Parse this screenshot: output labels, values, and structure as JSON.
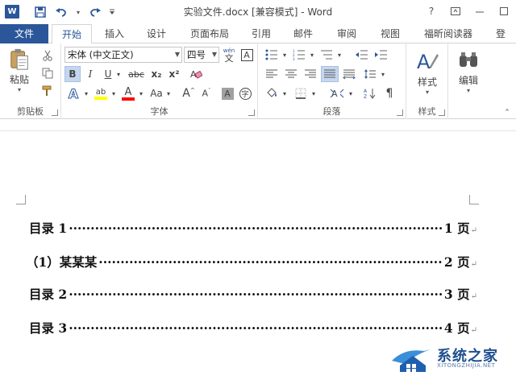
{
  "window": {
    "title": "实验文件.docx [兼容模式] - Word",
    "app_icon": "W",
    "controls": {
      "help": "?",
      "restore_ribbon": "⊡",
      "minimize": "—",
      "maximize": "□"
    }
  },
  "qat": {
    "save_icon": "save-icon",
    "undo_icon": "undo-icon",
    "redo_icon": "redo-icon"
  },
  "tabs": {
    "file": "文件",
    "items": [
      "开始",
      "插入",
      "设计",
      "页面布局",
      "引用",
      "邮件",
      "审阅",
      "视图",
      "福昕阅读器",
      "登"
    ],
    "active": "开始"
  },
  "ribbon": {
    "clipboard": {
      "paste_label": "粘贴",
      "group_label": "剪贴板"
    },
    "font": {
      "font_name": "宋体 (中文正文)",
      "font_size": "四号",
      "bold": "B",
      "italic": "I",
      "underline": "U",
      "strike": "abc",
      "subscript": "x₂",
      "superscript": "x²",
      "wen": "wén",
      "case": "Aa",
      "group_label": "字体"
    },
    "paragraph": {
      "group_label": "段落"
    },
    "styles": {
      "label": "样式",
      "group_label": "样式"
    },
    "editing": {
      "label": "编辑"
    }
  },
  "document": {
    "toc": [
      {
        "title": "目录 1",
        "page": "1 页"
      },
      {
        "title": "（1）某某某",
        "page": "2 页"
      },
      {
        "title": "目录 2",
        "page": "3 页"
      },
      {
        "title": "目录 3",
        "page": "4 页"
      }
    ],
    "para_mark": "↵"
  },
  "watermark": {
    "text": "系统之家",
    "sub": "XITONGZHIJIA.NET"
  },
  "colors": {
    "accent": "#2b579a",
    "highlight": "#ffff00",
    "font_color": "#ff0000"
  }
}
